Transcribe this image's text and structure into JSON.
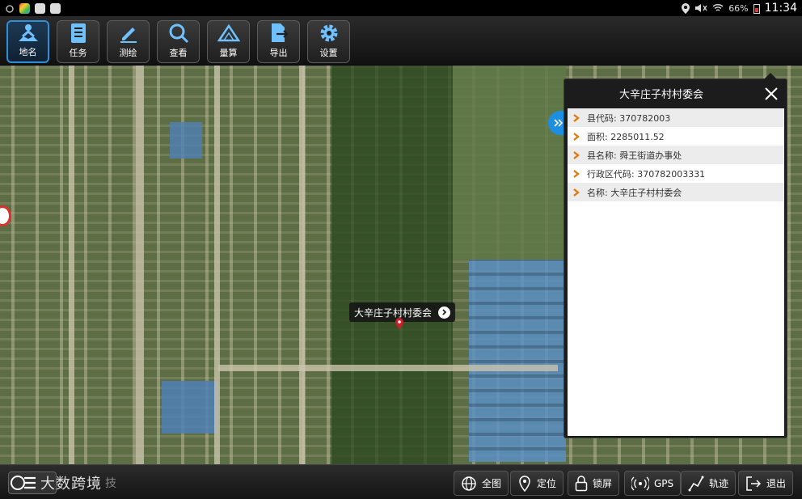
{
  "status_bar": {
    "battery": "66%",
    "time": "11:34"
  },
  "toolbar": {
    "tools": [
      {
        "label": "地名",
        "icon": "map-person-icon",
        "active": true
      },
      {
        "label": "任务",
        "icon": "task-list-icon",
        "active": false
      },
      {
        "label": "测绘",
        "icon": "pencil-icon",
        "active": false
      },
      {
        "label": "查看",
        "icon": "search-icon",
        "active": false
      },
      {
        "label": "量算",
        "icon": "measure-icon",
        "active": false
      },
      {
        "label": "导出",
        "icon": "export-icon",
        "active": false
      },
      {
        "label": "设置",
        "icon": "gear-icon",
        "active": false
      }
    ]
  },
  "map": {
    "marker_label": "大辛庄子村村委会"
  },
  "info_panel": {
    "title": "大辛庄子村村委会",
    "rows": [
      "县代码: 370782003",
      "面积: 2285011.52",
      "县名称: 舜王街道办事处",
      "行政区代码: 370782003331",
      "名称: 大辛庄子村村委会"
    ]
  },
  "bottom_bar": {
    "watermark": "大数跨境",
    "watermark_sub": "技",
    "buttons": [
      {
        "label": "全图",
        "icon": "globe-icon"
      },
      {
        "label": "定位",
        "icon": "location-pin-icon"
      },
      {
        "label": "锁屏",
        "icon": "lock-icon"
      },
      {
        "label": "GPS",
        "icon": "gps-signal-icon"
      },
      {
        "label": "轨迹",
        "icon": "track-line-icon"
      },
      {
        "label": "退出",
        "icon": "exit-icon"
      }
    ]
  },
  "colors": {
    "accent": "#2e8fd6",
    "marker": "#c8202a",
    "chevron": "#e07a12"
  }
}
